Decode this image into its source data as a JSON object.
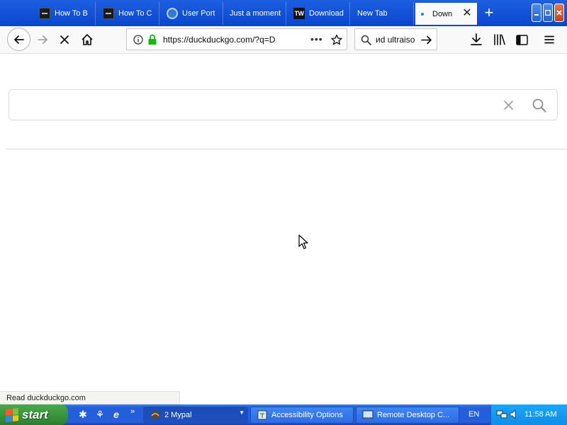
{
  "browser": {
    "tabs": [
      {
        "title": "How To B",
        "favicon": "dark-square-icon"
      },
      {
        "title": "How To C",
        "favicon": "dark-square-icon"
      },
      {
        "title": "User Port",
        "favicon": "refresh-globe-icon"
      },
      {
        "title": "Just a moment",
        "favicon": "none"
      },
      {
        "title": "Download",
        "favicon": "tw-icon"
      },
      {
        "title": "New Tab",
        "favicon": "none"
      },
      {
        "title": "Down",
        "favicon": "loading-dot-icon",
        "active": true
      }
    ],
    "url": "https://duckduckgo.com/?q=D",
    "url_host": "duckduckgo.com",
    "search_text": "иd ultraiso",
    "status_text": "Read duckduckgo.com"
  },
  "page": {
    "search_value": ""
  },
  "taskbar": {
    "start_label": "start",
    "buttons": [
      {
        "label": "2 Mypal",
        "icon": "mypal-icon"
      },
      {
        "label": "Accessibility Options",
        "icon": "accessibility-icon"
      },
      {
        "label": "Remote Desktop C...",
        "icon": "remote-desktop-icon"
      }
    ],
    "language": "EN",
    "clock": "11:58 AM"
  },
  "colors": {
    "tabstrip": "#0a45cf",
    "taskbar": "#245edb",
    "start": "#37923a",
    "accent": "#0a84ff"
  }
}
